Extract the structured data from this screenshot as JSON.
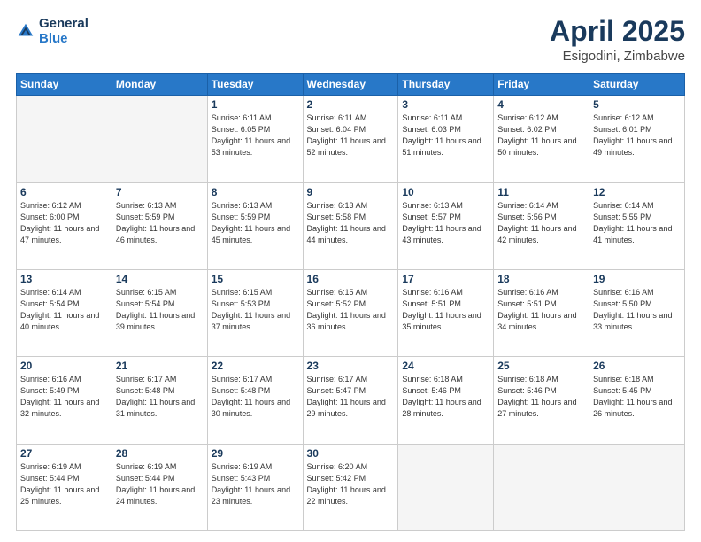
{
  "header": {
    "logo_general": "General",
    "logo_blue": "Blue",
    "month": "April 2025",
    "location": "Esigodini, Zimbabwe"
  },
  "weekdays": [
    "Sunday",
    "Monday",
    "Tuesday",
    "Wednesday",
    "Thursday",
    "Friday",
    "Saturday"
  ],
  "weeks": [
    [
      {
        "day": "",
        "info": ""
      },
      {
        "day": "",
        "info": ""
      },
      {
        "day": "1",
        "info": "Sunrise: 6:11 AM\nSunset: 6:05 PM\nDaylight: 11 hours and 53 minutes."
      },
      {
        "day": "2",
        "info": "Sunrise: 6:11 AM\nSunset: 6:04 PM\nDaylight: 11 hours and 52 minutes."
      },
      {
        "day": "3",
        "info": "Sunrise: 6:11 AM\nSunset: 6:03 PM\nDaylight: 11 hours and 51 minutes."
      },
      {
        "day": "4",
        "info": "Sunrise: 6:12 AM\nSunset: 6:02 PM\nDaylight: 11 hours and 50 minutes."
      },
      {
        "day": "5",
        "info": "Sunrise: 6:12 AM\nSunset: 6:01 PM\nDaylight: 11 hours and 49 minutes."
      }
    ],
    [
      {
        "day": "6",
        "info": "Sunrise: 6:12 AM\nSunset: 6:00 PM\nDaylight: 11 hours and 47 minutes."
      },
      {
        "day": "7",
        "info": "Sunrise: 6:13 AM\nSunset: 5:59 PM\nDaylight: 11 hours and 46 minutes."
      },
      {
        "day": "8",
        "info": "Sunrise: 6:13 AM\nSunset: 5:59 PM\nDaylight: 11 hours and 45 minutes."
      },
      {
        "day": "9",
        "info": "Sunrise: 6:13 AM\nSunset: 5:58 PM\nDaylight: 11 hours and 44 minutes."
      },
      {
        "day": "10",
        "info": "Sunrise: 6:13 AM\nSunset: 5:57 PM\nDaylight: 11 hours and 43 minutes."
      },
      {
        "day": "11",
        "info": "Sunrise: 6:14 AM\nSunset: 5:56 PM\nDaylight: 11 hours and 42 minutes."
      },
      {
        "day": "12",
        "info": "Sunrise: 6:14 AM\nSunset: 5:55 PM\nDaylight: 11 hours and 41 minutes."
      }
    ],
    [
      {
        "day": "13",
        "info": "Sunrise: 6:14 AM\nSunset: 5:54 PM\nDaylight: 11 hours and 40 minutes."
      },
      {
        "day": "14",
        "info": "Sunrise: 6:15 AM\nSunset: 5:54 PM\nDaylight: 11 hours and 39 minutes."
      },
      {
        "day": "15",
        "info": "Sunrise: 6:15 AM\nSunset: 5:53 PM\nDaylight: 11 hours and 37 minutes."
      },
      {
        "day": "16",
        "info": "Sunrise: 6:15 AM\nSunset: 5:52 PM\nDaylight: 11 hours and 36 minutes."
      },
      {
        "day": "17",
        "info": "Sunrise: 6:16 AM\nSunset: 5:51 PM\nDaylight: 11 hours and 35 minutes."
      },
      {
        "day": "18",
        "info": "Sunrise: 6:16 AM\nSunset: 5:51 PM\nDaylight: 11 hours and 34 minutes."
      },
      {
        "day": "19",
        "info": "Sunrise: 6:16 AM\nSunset: 5:50 PM\nDaylight: 11 hours and 33 minutes."
      }
    ],
    [
      {
        "day": "20",
        "info": "Sunrise: 6:16 AM\nSunset: 5:49 PM\nDaylight: 11 hours and 32 minutes."
      },
      {
        "day": "21",
        "info": "Sunrise: 6:17 AM\nSunset: 5:48 PM\nDaylight: 11 hours and 31 minutes."
      },
      {
        "day": "22",
        "info": "Sunrise: 6:17 AM\nSunset: 5:48 PM\nDaylight: 11 hours and 30 minutes."
      },
      {
        "day": "23",
        "info": "Sunrise: 6:17 AM\nSunset: 5:47 PM\nDaylight: 11 hours and 29 minutes."
      },
      {
        "day": "24",
        "info": "Sunrise: 6:18 AM\nSunset: 5:46 PM\nDaylight: 11 hours and 28 minutes."
      },
      {
        "day": "25",
        "info": "Sunrise: 6:18 AM\nSunset: 5:46 PM\nDaylight: 11 hours and 27 minutes."
      },
      {
        "day": "26",
        "info": "Sunrise: 6:18 AM\nSunset: 5:45 PM\nDaylight: 11 hours and 26 minutes."
      }
    ],
    [
      {
        "day": "27",
        "info": "Sunrise: 6:19 AM\nSunset: 5:44 PM\nDaylight: 11 hours and 25 minutes."
      },
      {
        "day": "28",
        "info": "Sunrise: 6:19 AM\nSunset: 5:44 PM\nDaylight: 11 hours and 24 minutes."
      },
      {
        "day": "29",
        "info": "Sunrise: 6:19 AM\nSunset: 5:43 PM\nDaylight: 11 hours and 23 minutes."
      },
      {
        "day": "30",
        "info": "Sunrise: 6:20 AM\nSunset: 5:42 PM\nDaylight: 11 hours and 22 minutes."
      },
      {
        "day": "",
        "info": ""
      },
      {
        "day": "",
        "info": ""
      },
      {
        "day": "",
        "info": ""
      }
    ]
  ]
}
